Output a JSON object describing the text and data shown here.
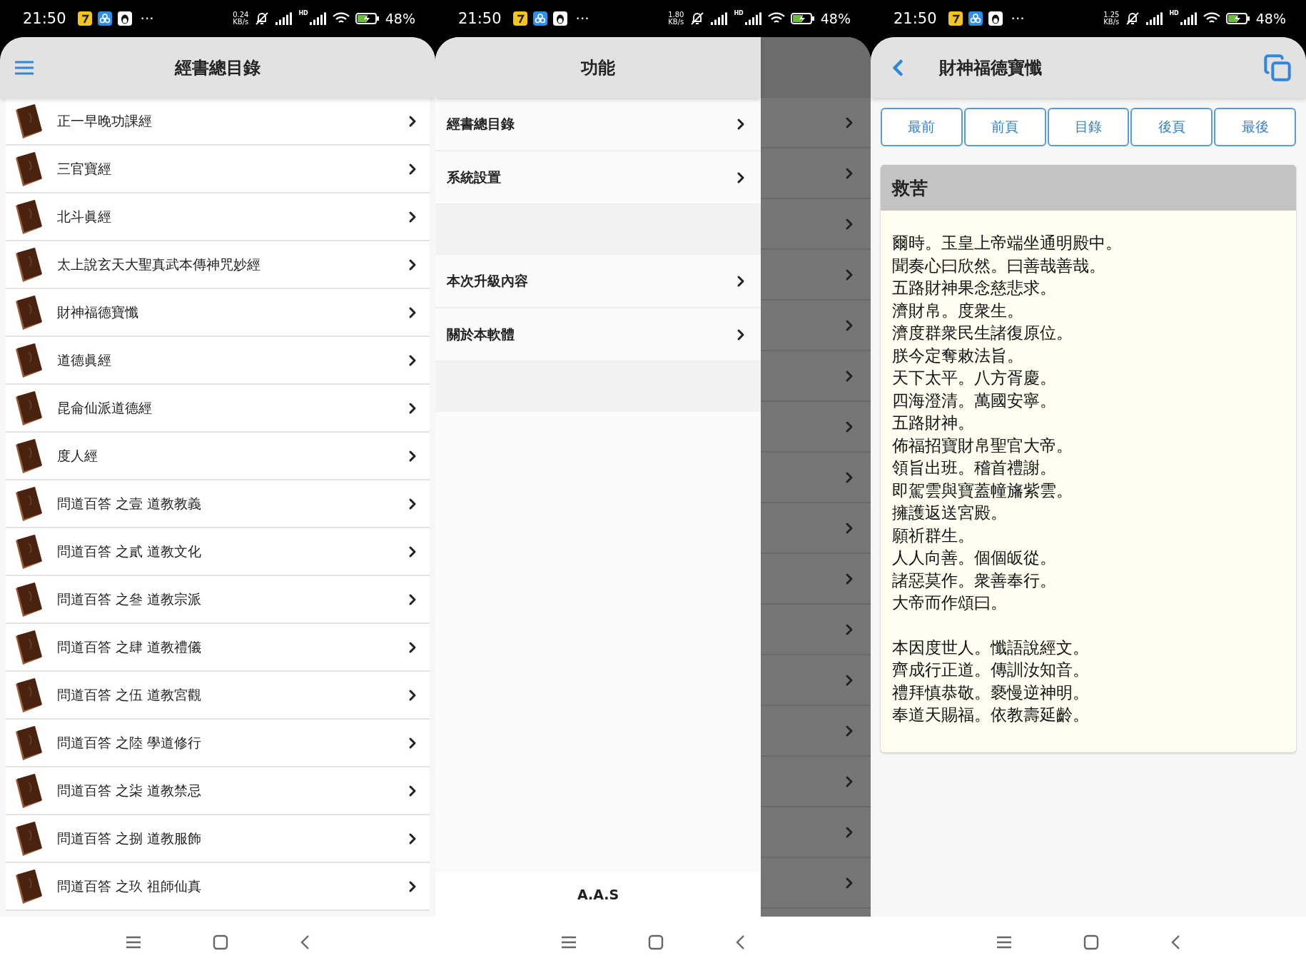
{
  "screens": [
    {
      "kind": "catalog",
      "status_bar": {
        "time": "21:50",
        "more": "···",
        "speed": "0.24",
        "speed_unit": "KB/s",
        "hd": "HD",
        "battery": "48%"
      },
      "header": {
        "title": "經書總目錄"
      },
      "items": [
        {
          "label": "正一早晚功課經"
        },
        {
          "label": "三官寶經"
        },
        {
          "label": "北斗眞經"
        },
        {
          "label": "太上說玄天大聖真武本傳神咒妙經"
        },
        {
          "label": "財神福德寶懺"
        },
        {
          "label": "道德眞經"
        },
        {
          "label": "昆侖仙派道德經"
        },
        {
          "label": "度人經"
        },
        {
          "label": "問道百答 之壹 道教教義"
        },
        {
          "label": "問道百答 之貳 道教文化"
        },
        {
          "label": "問道百答 之叄 道教宗派"
        },
        {
          "label": "問道百答 之肆 道教禮儀"
        },
        {
          "label": "問道百答 之伍 道教宮觀"
        },
        {
          "label": "問道百答 之陸 學道修行"
        },
        {
          "label": "問道百答 之柒 道教禁忌"
        },
        {
          "label": "問道百答 之捌 道教服飾"
        },
        {
          "label": "問道百答 之玖 祖師仙真"
        }
      ]
    },
    {
      "kind": "drawer",
      "status_bar": {
        "time": "21:50",
        "more": "···",
        "speed": "1.80",
        "speed_unit": "KB/s",
        "hd": "HD",
        "battery": "48%"
      },
      "header": {
        "title": "功能"
      },
      "items": [
        {
          "kind": "link",
          "label": "經書總目錄"
        },
        {
          "kind": "link",
          "label": "系統設置"
        },
        {
          "kind": "spacer"
        },
        {
          "kind": "link",
          "label": "本次升級內容"
        },
        {
          "kind": "link",
          "label": "關於本軟體"
        },
        {
          "kind": "spacer"
        }
      ],
      "footer": "A.A.S"
    },
    {
      "kind": "reader",
      "status_bar": {
        "time": "21:50",
        "more": "···",
        "speed": "1.25",
        "speed_unit": "KB/s",
        "hd": "HD",
        "battery": "48%"
      },
      "header": {
        "title": "財神福德寶懺"
      },
      "nav_buttons": [
        "最前",
        "前頁",
        "目錄",
        "後頁",
        "最後"
      ],
      "section": {
        "title": "救苦",
        "paragraphs": [
          [
            "爾時。玉皇上帝端坐通明殿中。",
            "聞奏心曰欣然。曰善哉善哉。",
            "五路財神果念慈悲求。",
            "濟財帛。度衆生。",
            "濟度群衆民生諸復原位。",
            "朕今定奪敕法旨。",
            "天下太平。八方胥慶。",
            "四海澄清。萬國安寧。",
            "五路財神。",
            "佈福招寶財帛聖官大帝。",
            "領旨出班。稽首禮謝。",
            "即駕雲與寶蓋幢旛紫雲。",
            "擁護返送宮殿。",
            "願祈群生。",
            "人人向善。個個皈從。",
            "諸惡莫作。衆善奉行。",
            "大帝而作頌曰。"
          ],
          [
            "本因度世人。懺語說經文。",
            "齊成行正道。傳訓汝知音。",
            "禮拜慎恭敬。褻慢逆神明。",
            "奉道天賜福。依教壽延齡。"
          ]
        ]
      }
    }
  ]
}
